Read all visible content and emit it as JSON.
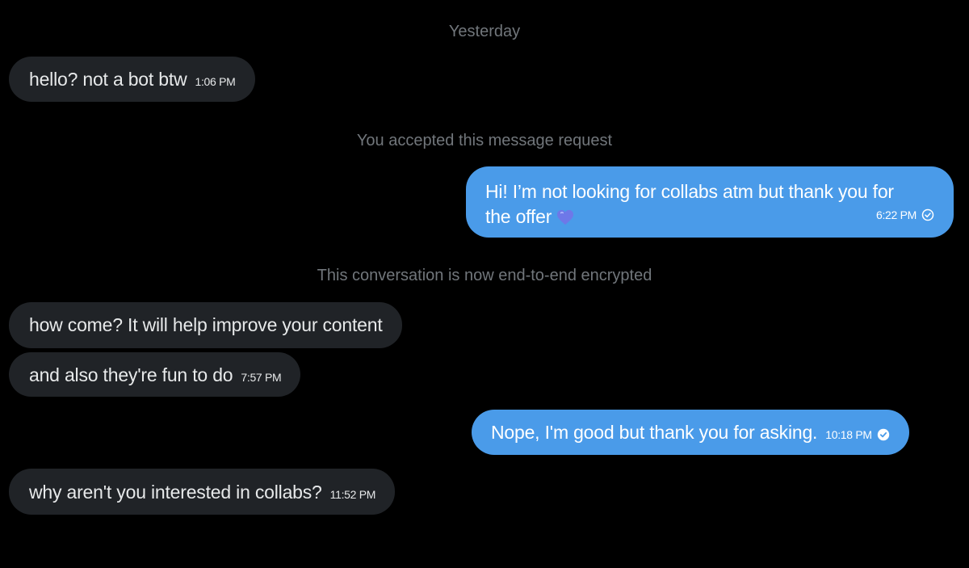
{
  "dividers": {
    "day": "Yesterday",
    "accepted": "You accepted this message request",
    "encrypted": "This conversation is now end-to-end encrypted"
  },
  "messages": [
    {
      "direction": "incoming",
      "text": "hello? not a bot btw",
      "time": "1:06 PM"
    },
    {
      "direction": "outgoing",
      "text": "Hi! I’m not looking for collabs atm but thank you for the offer",
      "emoji": "blue-heart",
      "time": "6:22 PM",
      "status": "sent"
    },
    {
      "direction": "incoming",
      "text": "how come? It will help improve your content",
      "time": ""
    },
    {
      "direction": "incoming",
      "text": "and also they're fun to do",
      "time": "7:57 PM"
    },
    {
      "direction": "outgoing",
      "text": "Nope, I'm good but thank you for asking.",
      "time": "10:18 PM",
      "status": "read"
    },
    {
      "direction": "incoming",
      "text": "why aren't you interested in collabs?",
      "time": "11:52 PM"
    }
  ],
  "colors": {
    "background": "#000000",
    "incoming_bubble": "#202327",
    "outgoing_bubble": "#4a9be9",
    "system_text": "#71767b"
  }
}
